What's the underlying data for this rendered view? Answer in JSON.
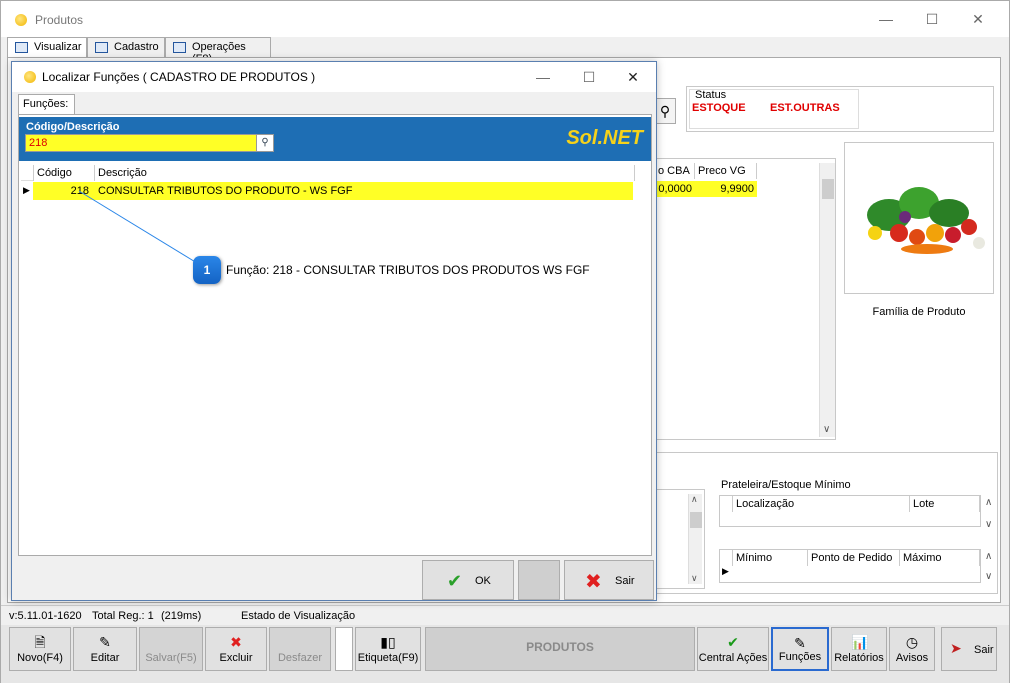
{
  "window": {
    "title": "Produtos",
    "controls": {
      "minimize": "—",
      "maximize": "☐",
      "close": "✕"
    }
  },
  "tabs": [
    {
      "label": "Visualizar"
    },
    {
      "label": "Cadastro"
    },
    {
      "label": "Operações (F8)"
    }
  ],
  "status_box": {
    "label": "Status",
    "values": [
      "ESTOQUE",
      "EST.OUTRAS"
    ]
  },
  "price_table": {
    "headers": [
      "o CBA",
      "Preco VG"
    ],
    "row": [
      "0,0000",
      "9,9900"
    ]
  },
  "family_image": {
    "caption": "Família de Produto"
  },
  "shelf_box": {
    "label": "Prateleira/Estoque Mínimo",
    "grid1_headers": [
      "Localização",
      "Lote"
    ],
    "grid2_headers": [
      "Mínimo",
      "Ponto de Pedido",
      "Máximo"
    ]
  },
  "statusbar": {
    "version": "v:5.11.01-1620",
    "total": "Total Reg.: 1",
    "time": "(219ms)",
    "state": "Estado de Visualização"
  },
  "toolbar": {
    "novo": "Novo(F4)",
    "editar": "Editar",
    "salvar": "Salvar(F5)",
    "excluir": "Excluir",
    "desfazer": "Desfazer",
    "etiqueta": "Etiqueta(F9)",
    "module": "PRODUTOS",
    "central": "Central Ações",
    "funcoes": "Funções",
    "relatorios": "Relatórios",
    "avisos": "Avisos",
    "sair": "Sair"
  },
  "dialog": {
    "title": "Localizar Funções  ( CADASTRO DE PRODUTOS )",
    "tab": "Funções:",
    "search_label": "Código/Descrição",
    "search_value": "218",
    "brand": "Sol.NET",
    "grid_headers": [
      "Código",
      "Descrição"
    ],
    "rows": [
      {
        "codigo": "218",
        "descricao": "CONSULTAR TRIBUTOS DO PRODUTO - WS FGF"
      }
    ],
    "ok_label": "OK",
    "sair_label": "Sair"
  },
  "callout": {
    "number": "1",
    "text": "Função: 218 - CONSULTAR TRIBUTOS DOS PRODUTOS WS FGF"
  },
  "colors": {
    "highlight_yellow": "#ffff26",
    "search_band_blue": "#1e6eb4",
    "status_red": "#e00000",
    "callout_blue": "#1a74d9"
  }
}
